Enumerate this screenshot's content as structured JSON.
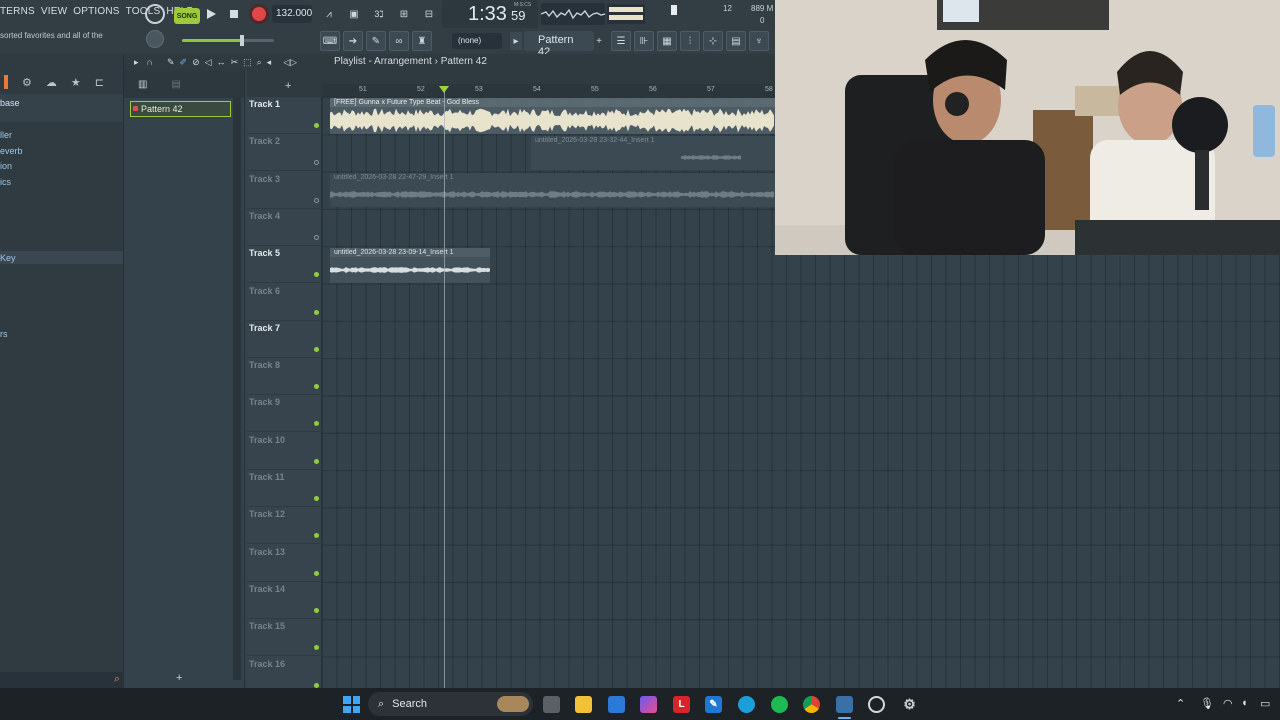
{
  "menu": [
    "TERNS",
    "VIEW",
    "OPTIONS",
    "TOOLS",
    "HELP"
  ],
  "hint_text": "sorted favorites and all of the",
  "transport": {
    "mode": "SONG",
    "tempo": "132.000",
    "time_main": "1:33",
    "time_sub": "59",
    "time_label": "M:S:CS",
    "cpu_value": "12",
    "mem_value": "889 M",
    "zero_value": "0"
  },
  "toolbar": {
    "snap_value": "(none)",
    "pattern_selector": "Pattern 42"
  },
  "browser": {
    "items": [
      "base",
      "ller",
      "everb",
      "ion",
      "ics",
      "Key",
      "rs"
    ],
    "selected_index": 5
  },
  "pattern_list": {
    "current": "Pattern 42"
  },
  "playlist": {
    "breadcrumb": [
      "Playlist",
      "Arrangement",
      "Pattern 42"
    ],
    "ruler_numbers": [
      "51",
      "52",
      "53",
      "54",
      "55",
      "56",
      "57",
      "58"
    ],
    "tracks": [
      {
        "name": "Track 1",
        "active": true
      },
      {
        "name": "Track 2",
        "active": false
      },
      {
        "name": "Track 3",
        "active": false
      },
      {
        "name": "Track 4",
        "active": false
      },
      {
        "name": "Track 5",
        "active": true
      },
      {
        "name": "Track 6",
        "active": false
      },
      {
        "name": "Track 7",
        "active": true
      },
      {
        "name": "Track 8",
        "active": false
      },
      {
        "name": "Track 9",
        "active": false
      },
      {
        "name": "Track 10",
        "active": false
      },
      {
        "name": "Track 11",
        "active": false
      },
      {
        "name": "Track 12",
        "active": false
      },
      {
        "name": "Track 13",
        "active": false
      },
      {
        "name": "Track 14",
        "active": false
      },
      {
        "name": "Track 15",
        "active": false
      },
      {
        "name": "Track 16",
        "active": false
      }
    ],
    "clips": [
      {
        "title": "[FREE] Gunna x Future Type Beat - God Bless",
        "track": 1,
        "muted": false
      },
      {
        "title": "untitled_2026-03-28 23-32-44_Insert 1",
        "track": 2,
        "muted": true
      },
      {
        "title": "untitled_2026-03-28 22-47-29_Insert 1",
        "track": 3,
        "muted": true
      },
      {
        "title": "untitled_2026-03-28 23-09-14_Insert 1",
        "track": 5,
        "muted": false
      }
    ]
  },
  "taskbar": {
    "search_placeholder": "Search"
  },
  "colors": {
    "accent_green": "#9ec93b",
    "record_red": "#e04848",
    "playlist_bg": "#34424b"
  }
}
